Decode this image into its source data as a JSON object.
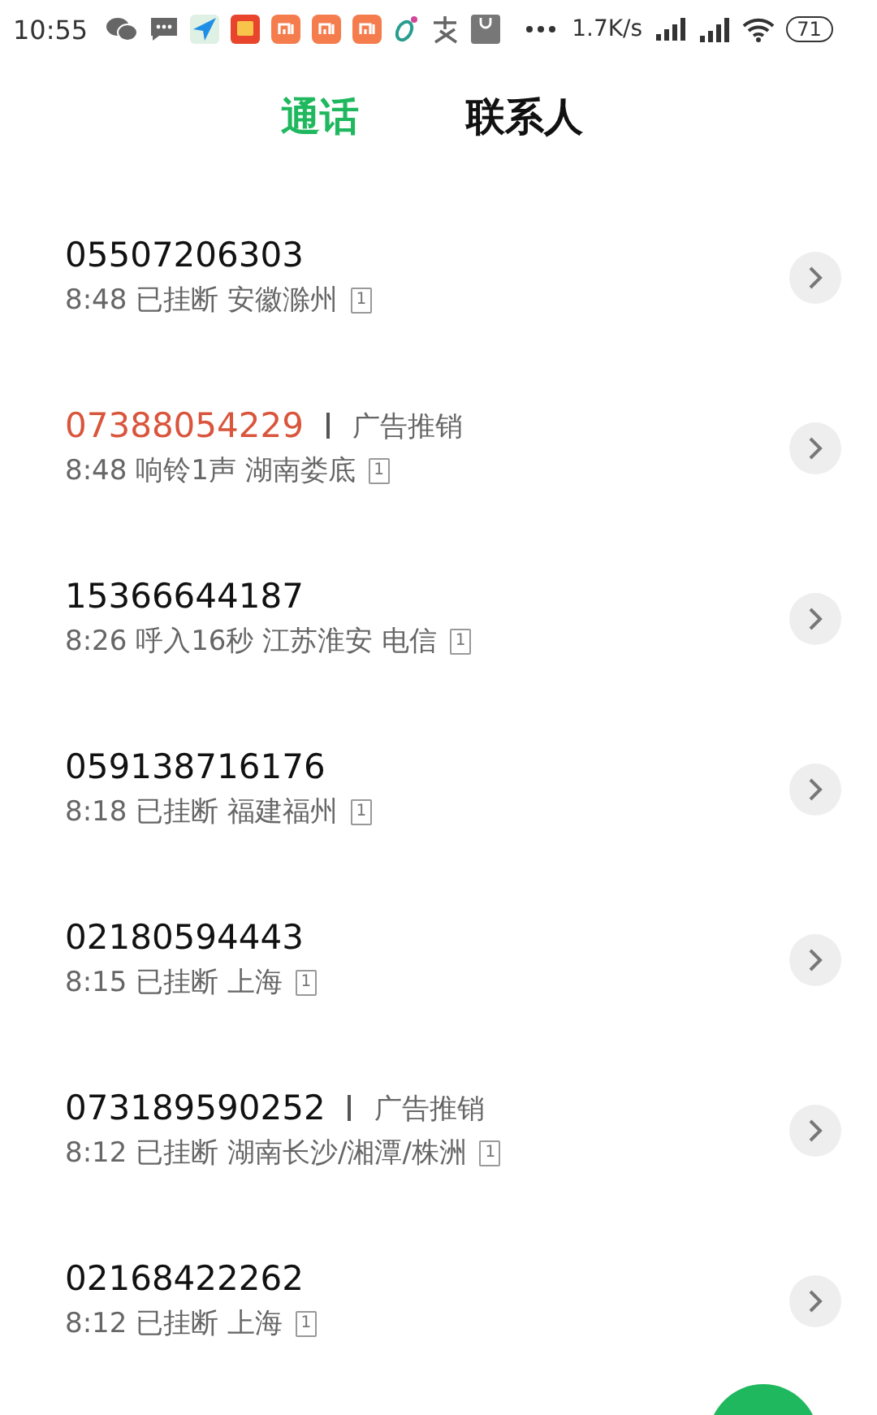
{
  "status_bar": {
    "time": "10:55",
    "speed": "1.7K/s",
    "battery": "71"
  },
  "tabs": [
    {
      "label": "通话",
      "selected": true
    },
    {
      "label": "联系人",
      "selected": false
    }
  ],
  "calls": [
    {
      "number": "05507206303",
      "missed": false,
      "time": "8:48",
      "status": "已挂断",
      "location": "安徽滁州",
      "sim": "1"
    },
    {
      "number": "07388054229",
      "missed": true,
      "tag": "广告推销",
      "time": "8:48",
      "status": "响铃1声",
      "location": "湖南娄底",
      "sim": "1"
    },
    {
      "number": "15366644187",
      "missed": false,
      "time": "8:26",
      "status": "呼入16秒",
      "location": "江苏淮安 电信",
      "sim": "1"
    },
    {
      "number": "059138716176",
      "missed": false,
      "time": "8:18",
      "status": "已挂断",
      "location": "福建福州",
      "sim": "1"
    },
    {
      "number": "02180594443",
      "missed": false,
      "time": "8:15",
      "status": "已挂断",
      "location": "上海",
      "sim": "1"
    },
    {
      "number": "073189590252",
      "missed": false,
      "tag": "广告推销",
      "time": "8:12",
      "status": "已挂断",
      "location": "湖南长沙/湘潭/株洲",
      "sim": "1"
    },
    {
      "number": "02168422262",
      "missed": false,
      "time": "8:12",
      "status": "已挂断",
      "location": "上海",
      "sim": "1"
    }
  ]
}
